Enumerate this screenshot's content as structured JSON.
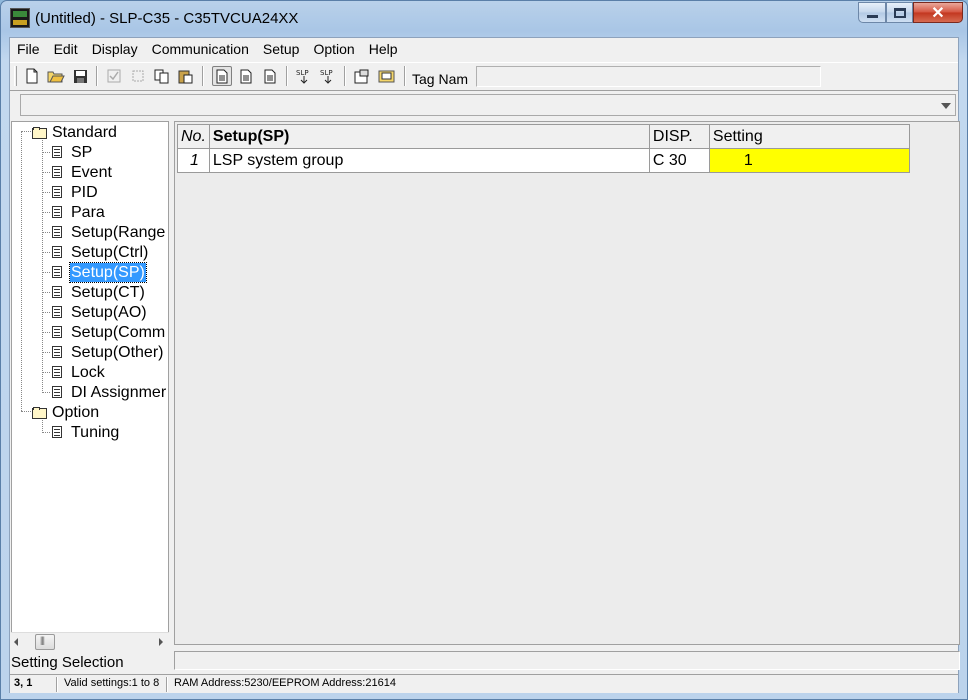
{
  "window": {
    "title": "(Untitled) - SLP-C35 - C35TVCUA24XX",
    "controls": {
      "minimize": "minimize-icon",
      "maximize": "maximize-icon",
      "close": "✕"
    }
  },
  "menu": [
    "File",
    "Edit",
    "Display",
    "Communication",
    "Setup",
    "Option",
    "Help"
  ],
  "toolbar": {
    "tag_label": "Tag Nam",
    "tag_value": "",
    "icons": [
      "new-icon",
      "open-icon",
      "save-icon",
      "check-icon",
      "cut-icon",
      "copy-icon",
      "paste-icon",
      "view1-icon",
      "view2-icon",
      "view3-icon",
      "slp-upload-icon",
      "slp-download-icon",
      "properties-icon",
      "monitor-icon"
    ]
  },
  "combo": {
    "value": ""
  },
  "tree": {
    "groups": [
      {
        "label": "Standard",
        "children": [
          "SP",
          "Event",
          "PID",
          "Para",
          "Setup(Range",
          "Setup(Ctrl)",
          "Setup(SP)",
          "Setup(CT)",
          "Setup(AO)",
          "Setup(Comm",
          "Setup(Other)",
          "Lock",
          "DI Assignmer"
        ]
      },
      {
        "label": "Option",
        "children": [
          "Tuning"
        ]
      }
    ],
    "selected": "Setup(SP)"
  },
  "setting_selection": "Setting Selection",
  "grid": {
    "headers": {
      "no": "No.",
      "name": "Setup(SP)",
      "disp": "DISP.",
      "setting": "Setting"
    },
    "rows": [
      {
        "no": "1",
        "name": "LSP system group",
        "disp": "C 30",
        "setting": "1",
        "highlight": "#ffff00"
      }
    ]
  },
  "message": "",
  "status": {
    "position": "3, 1",
    "valid": "Valid settings:1 to 8",
    "address": "RAM Address:5230/EEPROM Address:21614"
  }
}
